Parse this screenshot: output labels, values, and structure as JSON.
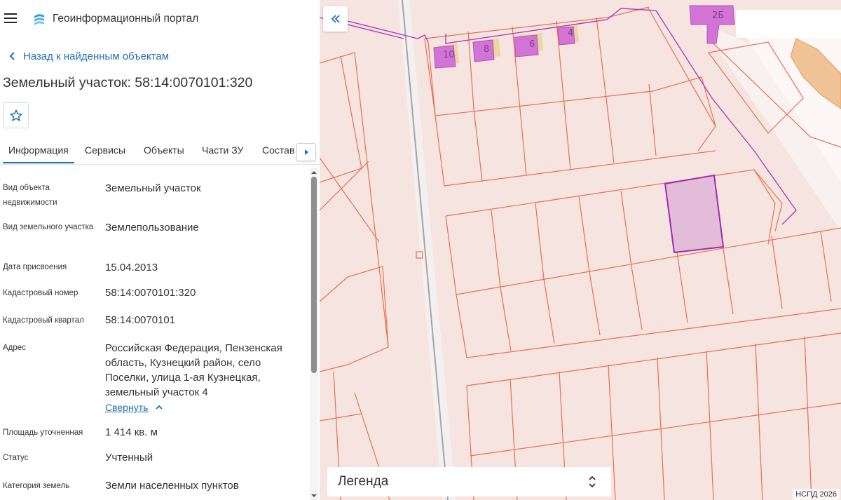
{
  "app": {
    "title": "Геоинформационный портал"
  },
  "sidebar": {
    "back_link": "Назад к найденным объектам",
    "object_title": "Земельный участок: 58:14:0070101:320",
    "tabs": [
      {
        "label": "Информация",
        "active": true
      },
      {
        "label": "Сервисы",
        "active": false
      },
      {
        "label": "Объекты",
        "active": false
      },
      {
        "label": "Части ЗУ",
        "active": false
      },
      {
        "label": "Состав",
        "active": false
      }
    ],
    "properties": [
      {
        "label": "Вид объекта недвижимости",
        "value": "Земельный участок"
      },
      {
        "label": "Вид земельного участка",
        "value": "Землепользование"
      },
      {
        "label": "Дата присвоения",
        "value": "15.04.2013"
      },
      {
        "label": "Кадастровый номер",
        "value": "58:14:0070101:320"
      },
      {
        "label": "Кадастровый квартал",
        "value": "58:14:0070101"
      },
      {
        "label": "Адрес",
        "value": "Российская Федерация, Пензенская область, Кузнецкий район, село Поселки, улица 1-ая Кузнецкая, земельный участок 4"
      },
      {
        "label": "Площадь уточненная",
        "value": "1 414 кв. м"
      },
      {
        "label": "Статус",
        "value": "Учтенный"
      },
      {
        "label": "Категория земель",
        "value": "Земли населенных пунктов"
      }
    ],
    "collapse_link": "Свернуть"
  },
  "map": {
    "house_numbers": [
      "10",
      "8",
      "6",
      "4",
      "2Б"
    ],
    "legend_label": "Легенда",
    "attribution": "НСПД 2026",
    "search_value": ""
  },
  "colors": {
    "accent": "#1f6fb5",
    "map_background": "#f6e4e0",
    "parcel_line": "#e8704f",
    "selected_parcel_fill": "#e2bcd8",
    "selected_parcel_stroke": "#a22ab2",
    "building_fill": "#d274d6",
    "building_secondary": "#e9d8a0"
  },
  "icons": {
    "menu": "hamburger-icon",
    "logo": "portal-logo-icon",
    "back": "chevron-left-icon",
    "favorite": "star-icon",
    "tabs_next": "caret-right-icon",
    "collapse": "double-chevron-left-icon",
    "legend_toggle": "unfold-icon",
    "collapse_link": "chevron-up-icon"
  }
}
